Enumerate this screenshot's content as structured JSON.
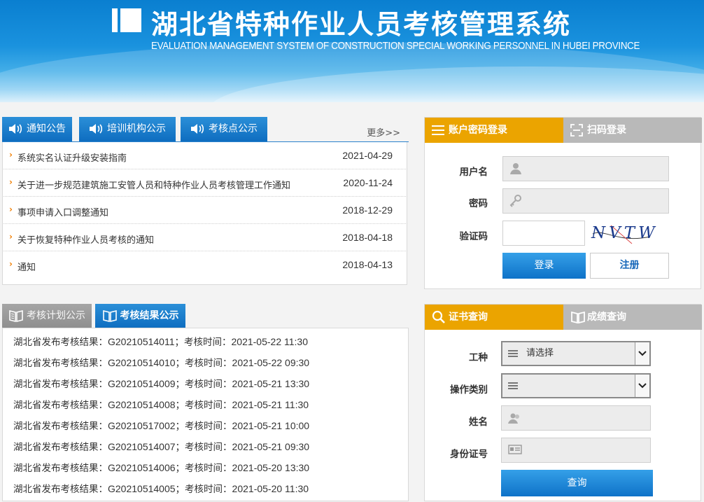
{
  "header": {
    "title_cn": "湖北省特种作业人员考核管理系统",
    "title_en": "EVALUATION MANAGEMENT SYSTEM OF CONSTRUCTION SPECIAL WORKING PERSONNEL IN HUBEI PROVINCE"
  },
  "news": {
    "tabs": [
      {
        "label": "通知公告",
        "icon": "speaker-icon"
      },
      {
        "label": "培训机构公示",
        "icon": "speaker-icon"
      },
      {
        "label": "考核点公示",
        "icon": "speaker-icon"
      }
    ],
    "more_label": "更多>>",
    "items": [
      {
        "text": "系统实名认证升级安装指南",
        "date": "2021-04-29"
      },
      {
        "text": "关于进一步规范建筑施工安管人员和特种作业人员考核管理工作通知",
        "date": "2020-11-24"
      },
      {
        "text": "事项申请入口调整通知",
        "date": "2018-12-29"
      },
      {
        "text": "关于恢复特种作业人员考核的通知",
        "date": "2018-04-18"
      },
      {
        "text": "通知",
        "date": "2018-04-13"
      }
    ]
  },
  "exam": {
    "tabs": [
      {
        "label": "考核计划公示",
        "icon": "book-icon"
      },
      {
        "label": "考核结果公示",
        "icon": "book-icon"
      }
    ],
    "results": [
      {
        "prefix": "湖北省发布考核结果：",
        "code": "G20210514011",
        "mid": "；考核时间：",
        "time": "2021-05-22 11:30"
      },
      {
        "prefix": "湖北省发布考核结果：",
        "code": "G20210514010",
        "mid": "；考核时间：",
        "time": "2021-05-22 09:30"
      },
      {
        "prefix": "湖北省发布考核结果：",
        "code": "G20210514009",
        "mid": "；考核时间：",
        "time": "2021-05-21 13:30"
      },
      {
        "prefix": "湖北省发布考核结果：",
        "code": "G20210514008",
        "mid": "；考核时间：",
        "time": "2021-05-21 11:30"
      },
      {
        "prefix": "湖北省发布考核结果：",
        "code": "G20210517002",
        "mid": "；考核时间：",
        "time": "2021-05-21 10:00"
      },
      {
        "prefix": "湖北省发布考核结果：",
        "code": "G20210514007",
        "mid": "；考核时间：",
        "time": "2021-05-21 09:30"
      },
      {
        "prefix": "湖北省发布考核结果：",
        "code": "G20210514006",
        "mid": "；考核时间：",
        "time": "2021-05-20 13:30"
      },
      {
        "prefix": "湖北省发布考核结果：",
        "code": "G20210514005",
        "mid": "；考核时间：",
        "time": "2021-05-20 11:30"
      }
    ]
  },
  "login": {
    "tab_password": "账户密码登录",
    "tab_scan": "扫码登录",
    "username_label": "用户名",
    "password_label": "密码",
    "captcha_label": "验证码",
    "captcha_text": "NVTW",
    "login_button": "登录",
    "register_button": "注册"
  },
  "query": {
    "tab_cert": "证书查询",
    "tab_score": "成绩查询",
    "job_label": "工种",
    "job_value": "请选择",
    "category_label": "操作类别",
    "category_value": "",
    "name_label": "姓名",
    "id_label": "身份证号",
    "query_button": "查询"
  },
  "colors": {
    "blue": "#0d6cbf",
    "orange": "#eba400",
    "gray_tab": "#b9b9b9",
    "arrow": "#f07d00"
  }
}
